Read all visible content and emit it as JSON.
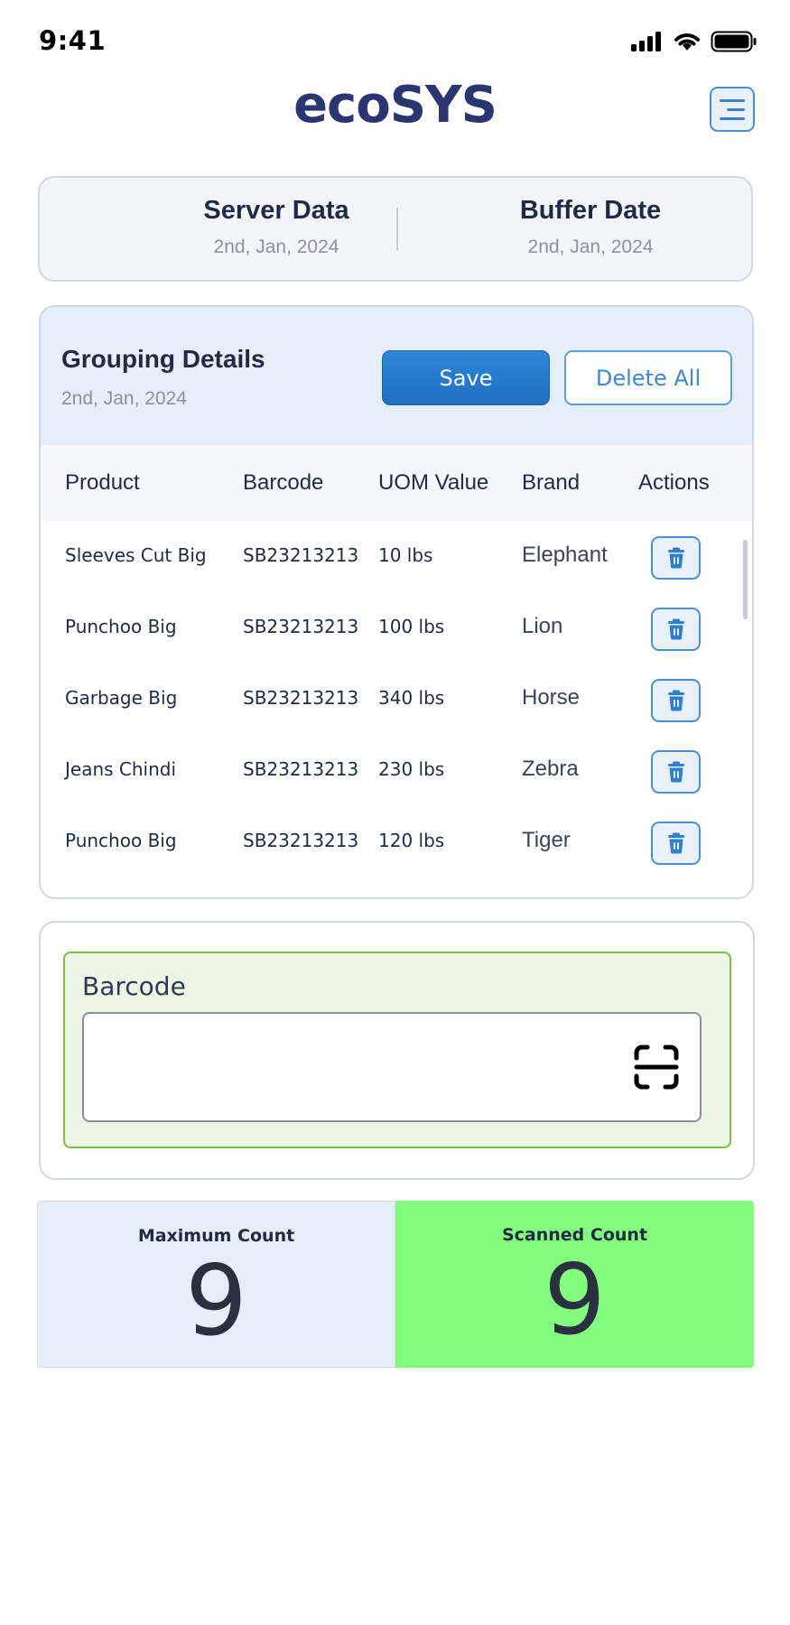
{
  "status_bar": {
    "time": "9:41"
  },
  "header": {
    "title": "ecoSYS"
  },
  "sync": {
    "server": {
      "title": "Server Data",
      "date": "2nd, Jan, 2024"
    },
    "buffer": {
      "title": "Buffer Date",
      "date": "2nd, Jan, 2024"
    }
  },
  "grouping": {
    "title": "Grouping Details",
    "date": "2nd, Jan, 2024",
    "save_label": "Save",
    "delete_all_label": "Delete All",
    "columns": [
      "Product",
      "Barcode",
      "UOM Value",
      "Brand",
      "Actions"
    ],
    "rows": [
      {
        "product": "Sleeves Cut Big",
        "barcode": "SB23213213",
        "uom": "10 lbs",
        "brand": "Elephant"
      },
      {
        "product": "Punchoo Big",
        "barcode": "SB23213213",
        "uom": "100 lbs",
        "brand": "Lion"
      },
      {
        "product": "Garbage Big",
        "barcode": "SB23213213",
        "uom": "340 lbs",
        "brand": "Horse"
      },
      {
        "product": "Jeans Chindi",
        "barcode": "SB23213213",
        "uom": "230 lbs",
        "brand": "Zebra"
      },
      {
        "product": "Punchoo Big",
        "barcode": "SB23213213",
        "uom": "120 lbs",
        "brand": "Tiger"
      }
    ],
    "row_action_icon": "trash-icon"
  },
  "barcode": {
    "label": "Barcode",
    "value": "",
    "scan_icon": "scan-icon"
  },
  "counts": {
    "maximum": {
      "label": "Maximum Count",
      "value": "9"
    },
    "scanned": {
      "label": "Scanned Count",
      "value": "9"
    }
  },
  "colors": {
    "brand": "#2b3572",
    "accent": "#1f6fc2",
    "scan_border": "#7cc242",
    "scanned_bg": "#83fd7e"
  }
}
